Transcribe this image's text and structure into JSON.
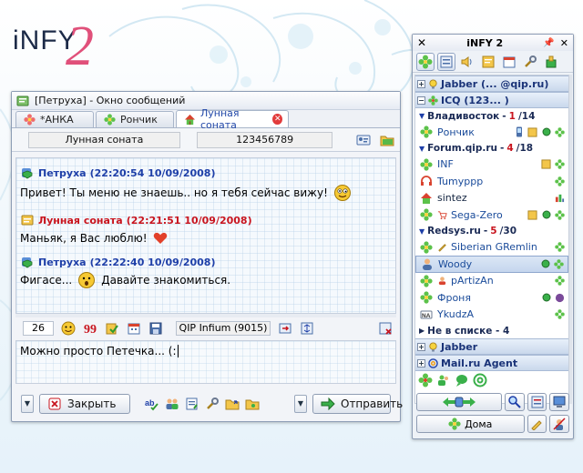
{
  "logo": {
    "text": "iNFY",
    "number": "2"
  },
  "message_window": {
    "title": "[Петруха] - Окно сообщений",
    "tabs": [
      {
        "label": "*АНКА",
        "icon": "flower-icon"
      },
      {
        "label": "Рончик",
        "icon": "flower-icon"
      },
      {
        "label": "Лунная соната",
        "icon": "house-icon",
        "active": true
      }
    ],
    "contact_name": "Лунная соната",
    "contact_uin": "123456789",
    "messages": [
      {
        "author": "Петруха",
        "time": "(22:20:54 10/09/2008)",
        "text": "Привет! Ты меню не знаешь.. но я тебя сейчас вижу!",
        "color": "#1e3fa8"
      },
      {
        "author": "Лунная соната",
        "time": "(22:21:51 10/09/2008)",
        "text": "Маньяк, я Вас люблю!",
        "color": "#c8141e"
      },
      {
        "author": "Петруха",
        "time": "(22:22:40 10/09/2008)",
        "text_before": "Фигасе...",
        "text_after": "Давайте знакомиться.",
        "color": "#1e3fa8"
      }
    ],
    "char_count": "26",
    "client_info": "QIP Infium (9015)",
    "input_text": "Можно просто Петечка... (:",
    "close_label": "Закрыть",
    "send_label": "Отправить"
  },
  "contact_list": {
    "title": "iNFY 2",
    "accounts": {
      "jabber": "Jabber (... @qip.ru)",
      "icq": "ICQ (123... )",
      "jabber2": "Jabber",
      "mailru": "Mail.ru Agent"
    },
    "groups": [
      {
        "name": "Владивосток",
        "sep": " - ",
        "online": "1",
        "total": "/14"
      },
      {
        "name": "Forum.qip.ru",
        "sep": " - ",
        "online": "4",
        "total": "/18"
      },
      {
        "name": "Redsys.ru",
        "sep": " - ",
        "online": "5",
        "total": "/30"
      }
    ],
    "not_in_list": "Не в списке - 4",
    "contacts": [
      {
        "name": "Рончик",
        "status": "online"
      },
      {
        "name": "INF",
        "status": "online"
      },
      {
        "name": "Tumyppp",
        "status": "online"
      },
      {
        "name": "sintez",
        "status": "offline"
      },
      {
        "name": "Sega-Zero",
        "status": "online"
      },
      {
        "name": "Siberian GRemlin",
        "status": "online"
      },
      {
        "name": "Woody",
        "status": "online"
      },
      {
        "name": "pArtizAn",
        "status": "online"
      },
      {
        "name": "Фроня",
        "status": "online"
      },
      {
        "name": "YkudzA",
        "status": "online"
      }
    ],
    "status_button": "Дома"
  },
  "colors": {
    "accent": "#1e3fa8",
    "red": "#c8141e",
    "icq_green": "#3aa83a"
  }
}
